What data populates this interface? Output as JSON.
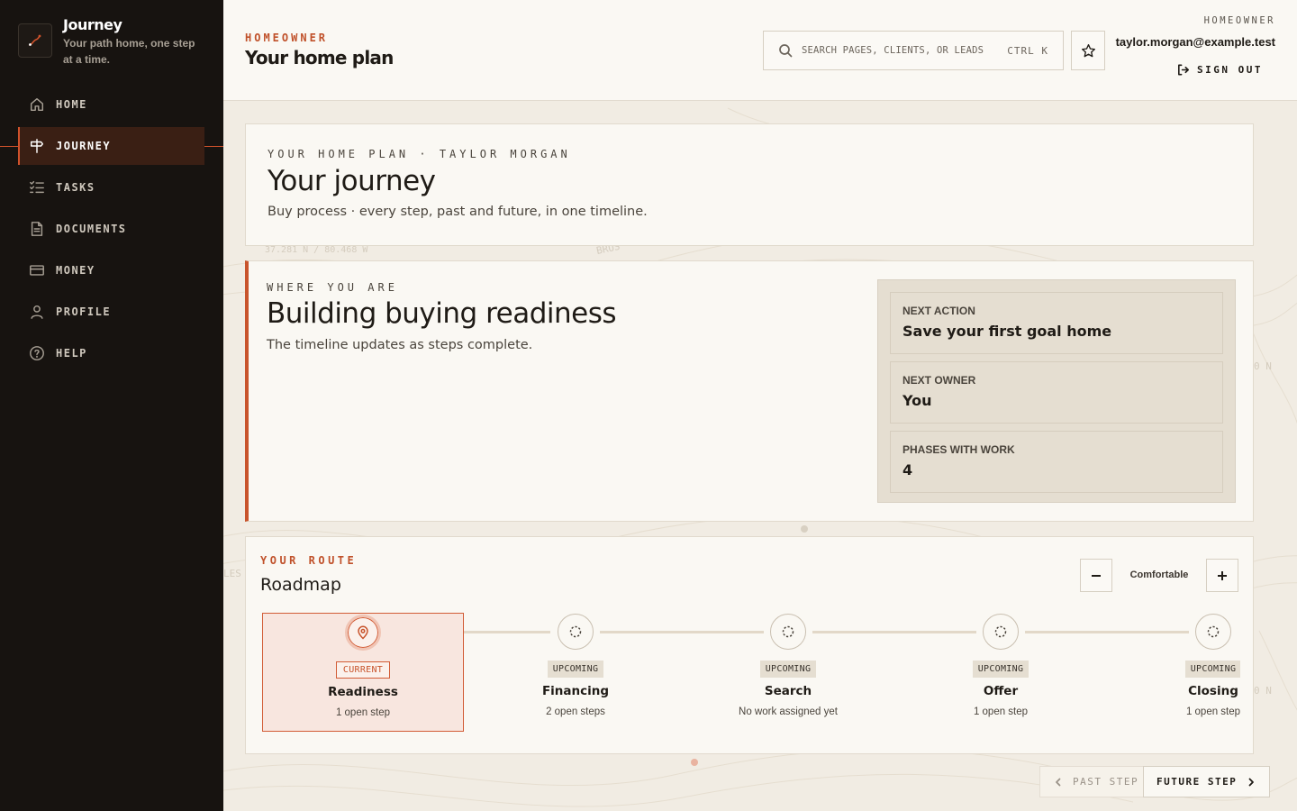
{
  "brand": {
    "title": "Journey",
    "tagline": "Your path home, one step at a time."
  },
  "nav": {
    "items": [
      {
        "label": "HOME",
        "icon": "home-icon"
      },
      {
        "label": "JOURNEY",
        "icon": "signpost-icon",
        "active": true
      },
      {
        "label": "TASKS",
        "icon": "checklist-icon"
      },
      {
        "label": "DOCUMENTS",
        "icon": "document-icon"
      },
      {
        "label": "MONEY",
        "icon": "card-icon"
      },
      {
        "label": "PROFILE",
        "icon": "user-icon"
      },
      {
        "label": "HELP",
        "icon": "help-icon"
      }
    ]
  },
  "header": {
    "eyebrow": "HOMEOWNER",
    "title": "Your home plan",
    "search_placeholder": "SEARCH PAGES, CLIENTS, OR LEADS",
    "search_shortcut": "CTRL K",
    "role": "HOMEOWNER",
    "email": "taylor.morgan@example.test",
    "signout_label": "SIGN OUT"
  },
  "journey": {
    "kicker": "YOUR HOME PLAN · TAYLOR MORGAN",
    "title": "Your journey",
    "subtitle": "Buy process · every step, past and future, in one timeline."
  },
  "where": {
    "kicker": "WHERE YOU ARE",
    "title": "Building buying readiness",
    "subtitle": "The timeline updates as steps complete.",
    "stats": [
      {
        "label": "NEXT ACTION",
        "value": "Save your first goal home"
      },
      {
        "label": "NEXT OWNER",
        "value": "You"
      },
      {
        "label": "PHASES WITH WORK",
        "value": "4"
      }
    ]
  },
  "route": {
    "eyebrow": "YOUR ROUTE",
    "title": "Roadmap",
    "density": "Comfortable",
    "stages": [
      {
        "badge": "CURRENT",
        "name": "Readiness",
        "meta": "1 open step",
        "current": true
      },
      {
        "badge": "UPCOMING",
        "name": "Financing",
        "meta": "2 open steps"
      },
      {
        "badge": "UPCOMING",
        "name": "Search",
        "meta": "No work assigned yet"
      },
      {
        "badge": "UPCOMING",
        "name": "Offer",
        "meta": "1 open step"
      },
      {
        "badge": "UPCOMING",
        "name": "Closing",
        "meta": "1 open step"
      }
    ]
  },
  "pager": {
    "prev_label": "PAST STEP",
    "next_label": "FUTURE STEP"
  },
  "map": {
    "coord_label": "37.281 N / 80.468 W",
    "label_brush": "BRUS",
    "label_les": "LES",
    "label_n1": "0 N",
    "label_n2": "0 N"
  },
  "colors": {
    "accent": "#c8542c",
    "sidebar_bg": "#171310",
    "card_bg": "#faf8f3"
  }
}
